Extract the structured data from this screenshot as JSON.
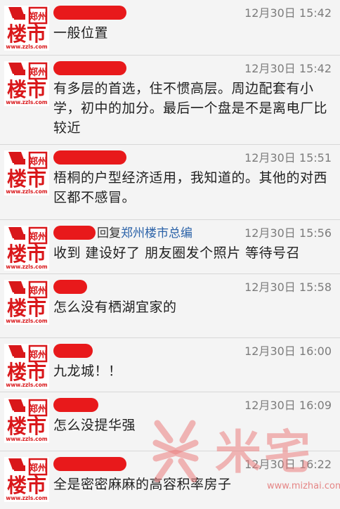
{
  "avatar": {
    "brand_text": "楼市",
    "small_text": "郑州",
    "site": "www.zzls.com"
  },
  "comments": [
    {
      "time": "12月30日 15:42",
      "text": "一般位置",
      "reply_word": "",
      "reply_target": ""
    },
    {
      "time": "12月30日 15:42",
      "text": "有多层的首选，住不惯高层。周边配套有小学，初中的加分。最后一个盘是不是离电厂比较近",
      "reply_word": "",
      "reply_target": ""
    },
    {
      "time": "12月30日 15:51",
      "text": "梧桐的户型经济适用，我知道的。其他的对西区都不感冒。",
      "reply_word": "",
      "reply_target": ""
    },
    {
      "time": "12月30日 15:56",
      "text": "收到 建设好了 朋友圈发个照片 等待号召",
      "reply_word": "回复",
      "reply_target": "郑州楼市总编"
    },
    {
      "time": "12月30日 15:58",
      "text": "怎么没有栖湖宜家的",
      "reply_word": "",
      "reply_target": ""
    },
    {
      "time": "12月30日 16:00",
      "text": "九龙城！！",
      "reply_word": "",
      "reply_target": ""
    },
    {
      "time": "12月30日 16:09",
      "text": "怎么没提华强",
      "reply_word": "",
      "reply_target": ""
    },
    {
      "time": "12月30日 16:22",
      "text": "全是密密麻麻的高容积率房子",
      "reply_word": "",
      "reply_target": ""
    }
  ],
  "watermark": {
    "brand": "米宅",
    "url": "www.mizhai.com"
  }
}
